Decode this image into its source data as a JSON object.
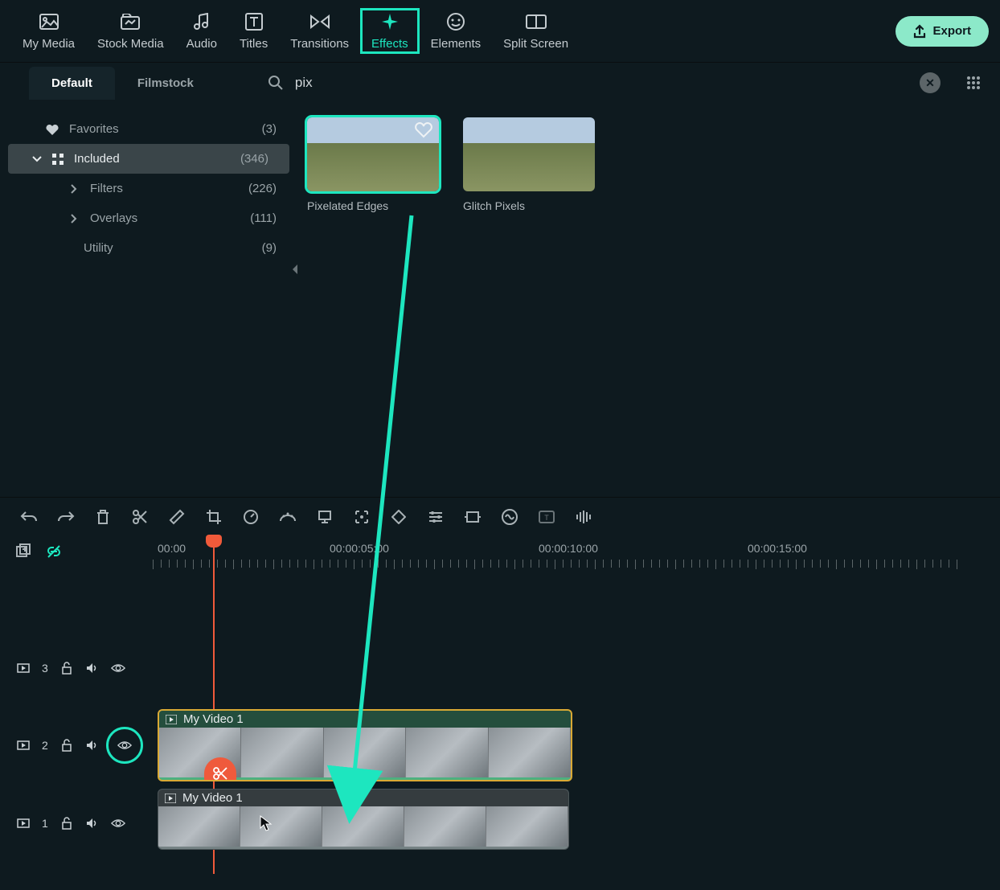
{
  "topnav": {
    "items": [
      {
        "label": "My Media",
        "icon": "image-icon"
      },
      {
        "label": "Stock Media",
        "icon": "folder-icon"
      },
      {
        "label": "Audio",
        "icon": "music-icon"
      },
      {
        "label": "Titles",
        "icon": "text-icon"
      },
      {
        "label": "Transitions",
        "icon": "transition-icon"
      },
      {
        "label": "Effects",
        "icon": "sparkle-icon"
      },
      {
        "label": "Elements",
        "icon": "face-icon"
      },
      {
        "label": "Split Screen",
        "icon": "split-icon"
      }
    ],
    "active_index": 5,
    "export_label": "Export"
  },
  "subnav": {
    "tabs": [
      "Default",
      "Filmstock"
    ],
    "active_index": 0
  },
  "search": {
    "value": "pix"
  },
  "sidebar": {
    "items": [
      {
        "label": "Favorites",
        "count": "(3)",
        "kind": "favorites"
      },
      {
        "label": "Included",
        "count": "(346)",
        "kind": "included"
      },
      {
        "label": "Filters",
        "count": "(226)",
        "kind": "child"
      },
      {
        "label": "Overlays",
        "count": "(111)",
        "kind": "child"
      },
      {
        "label": "Utility",
        "count": "(9)",
        "kind": "utility"
      }
    ]
  },
  "effects": [
    {
      "label": "Pixelated Edges",
      "selected": true,
      "has_fav": true
    },
    {
      "label": "Glitch Pixels",
      "selected": false,
      "has_fav": false
    }
  ],
  "ruler": {
    "labels": [
      "00:00",
      "00:00:05:00",
      "00:00:10:00",
      "00:00:15:00"
    ]
  },
  "tracks": [
    {
      "num": "3",
      "clip": null
    },
    {
      "num": "2",
      "clip": {
        "title": "My Video 1"
      },
      "eye_highlight": true
    },
    {
      "num": "1",
      "clip": {
        "title": "My Video 1"
      }
    }
  ],
  "colors": {
    "accent": "#1de6bf",
    "export": "#8ce9c9",
    "playhead": "#f05a3a",
    "clip_border": "#d9a934"
  }
}
